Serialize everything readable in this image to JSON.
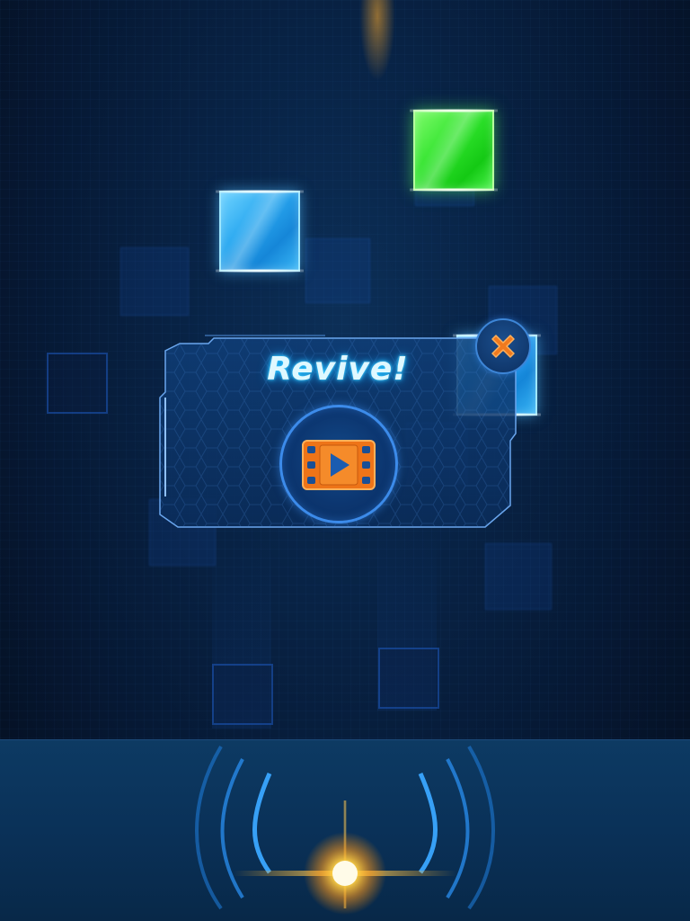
{
  "dialog": {
    "title": "Revive!",
    "watch_ad_icon": "video-play-icon",
    "close_icon": "close-x-icon"
  },
  "tiles": [
    {
      "color": "green",
      "lane": 3
    },
    {
      "color": "blue",
      "lane": 2
    },
    {
      "color": "blue",
      "lane": 4
    }
  ],
  "colors": {
    "accent": "#3c8bea",
    "title_glow": "#29c8ff",
    "button_orange": "#f07a1e",
    "tile_blue": "#2aa8f0",
    "tile_green": "#2ee22b",
    "emitter_glow": "#ffc23a"
  }
}
